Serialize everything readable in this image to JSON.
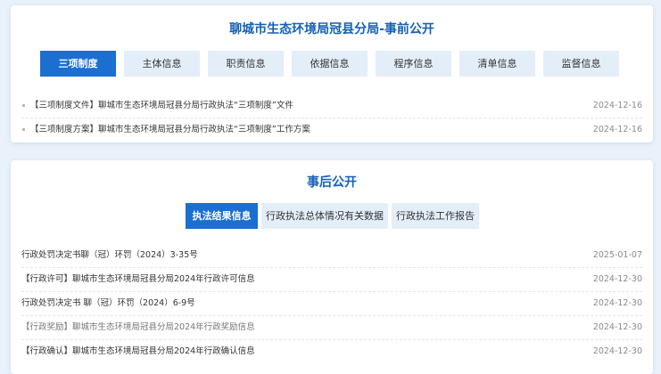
{
  "before": {
    "title": "聊城市生态环境局冠县分局-事前公开",
    "tabs": [
      {
        "label": "三项制度",
        "active": true
      },
      {
        "label": "主体信息",
        "active": false
      },
      {
        "label": "职责信息",
        "active": false
      },
      {
        "label": "依据信息",
        "active": false
      },
      {
        "label": "程序信息",
        "active": false
      },
      {
        "label": "清单信息",
        "active": false
      },
      {
        "label": "监督信息",
        "active": false
      }
    ],
    "items": [
      {
        "title": "【三项制度文件】聊城市生态环境局冠县分局行政执法“三项制度”文件",
        "date": "2024-12-16"
      },
      {
        "title": "【三项制度方案】聊城市生态环境局冠县分局行政执法“三项制度”工作方案",
        "date": "2024-12-16"
      }
    ]
  },
  "after": {
    "title": "事后公开",
    "tabs": [
      {
        "label": "执法结果信息",
        "active": true
      },
      {
        "label": "行政执法总体情况有关数据",
        "active": false
      },
      {
        "label": "行政执法工作报告",
        "active": false
      }
    ],
    "items": [
      {
        "title": "行政处罚决定书聊（冠）环罚（2024）3-35号",
        "date": "2025-01-07"
      },
      {
        "title": "【行政许可】聊城市生态环境局冠县分局2024年行政许可信息",
        "date": "2024-12-30"
      },
      {
        "title": "行政处罚决定书 聊（冠）环罚（2024）6-9号",
        "date": "2024-12-30"
      },
      {
        "title": "【行政奖励】聊城市生态环境局冠县分局2024年行政奖励信息",
        "date": "2024-12-30"
      },
      {
        "title": "【行政确认】聊城市生态环境局冠县分局2024年行政确认信息",
        "date": "2024-12-30"
      }
    ]
  }
}
